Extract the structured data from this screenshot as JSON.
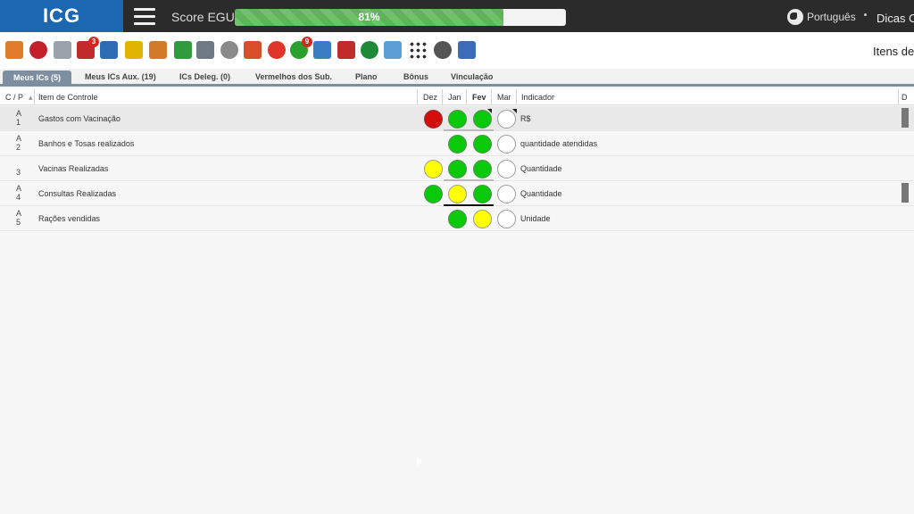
{
  "header": {
    "logo": "ICG",
    "score_label": "Score EGU:",
    "score_text": "81%",
    "score_fraction": 0.81,
    "language": "Português",
    "tips": "Dicas O"
  },
  "toolbar": {
    "icons": [
      {
        "name": "edit-icon",
        "color": "#e07b2a"
      },
      {
        "name": "target-icon",
        "color": "#c3202b"
      },
      {
        "name": "clipboard-icon",
        "color": "#9aa3ab"
      },
      {
        "name": "calendar-alert-icon",
        "color": "#c22b2b",
        "badge": "3"
      },
      {
        "name": "bar-chart-icon",
        "color": "#2d6db3"
      },
      {
        "name": "link-icon",
        "color": "#e0b400"
      },
      {
        "name": "people-icon",
        "color": "#d37a2a"
      },
      {
        "name": "award-icon",
        "color": "#2f9b3d"
      },
      {
        "name": "grid-calendar-icon",
        "color": "#6f7a84"
      },
      {
        "name": "stopwatch-icon",
        "color": "#8a8a8a"
      },
      {
        "name": "org-chart-icon",
        "color": "#d94f2b"
      },
      {
        "name": "crosshair-icon",
        "color": "#e0352b"
      },
      {
        "name": "check-badge-icon",
        "color": "#2ca02c",
        "badge": "9"
      },
      {
        "name": "building-icon",
        "color": "#3b7dc4"
      },
      {
        "name": "pdf-icon",
        "color": "#c22b2b"
      },
      {
        "name": "clock-icon",
        "color": "#1e8a3a"
      },
      {
        "name": "presentation-icon",
        "color": "#5c9fd6"
      },
      {
        "name": "apps-grid-icon",
        "color": "#333333"
      },
      {
        "name": "help-icon",
        "color": "#555555"
      },
      {
        "name": "rocket-icon",
        "color": "#3d6db8"
      }
    ],
    "right_label": "Itens de"
  },
  "tabs": [
    {
      "label": "Meus ICs (5)",
      "active": true
    },
    {
      "label": "Meus ICs Aux. (19)"
    },
    {
      "label": "ICs Deleg. (0)"
    },
    {
      "label": "Vermelhos dos Sub."
    },
    {
      "label": "Plano"
    },
    {
      "label": "Bônus"
    },
    {
      "label": "Vinculação"
    }
  ],
  "table": {
    "headers": {
      "cp": "C / P",
      "item": "Item de Controle",
      "dez": "Dez",
      "jan": "Jan",
      "fev": "Fev",
      "mar": "Mar",
      "indicador": "Indicador",
      "d": "D"
    },
    "rows": [
      {
        "c": "A",
        "p": "1",
        "item": "Gastos com Vacinação",
        "dez": "red",
        "jan": "green",
        "fev": "green",
        "mar": "empty",
        "indicador": "R$"
      },
      {
        "c": "A",
        "p": "2",
        "item": "Banhos e Tosas realizados",
        "dez": "",
        "jan": "green",
        "fev": "green",
        "mar": "empty",
        "indicador": "quantidade atendidas"
      },
      {
        "c": "",
        "p": "3",
        "item": "Vacinas Realizadas",
        "dez": "yellow",
        "jan": "green",
        "fev": "green",
        "mar": "empty",
        "indicador": "Quantidade"
      },
      {
        "c": "A",
        "p": "4",
        "item": "Consultas Realizadas",
        "dez": "green",
        "jan": "yellow",
        "fev": "green",
        "mar": "empty",
        "indicador": "Quantidade"
      },
      {
        "c": "A",
        "p": "5",
        "item": "Rações vendidas",
        "dez": "",
        "jan": "green",
        "fev": "yellow",
        "mar": "empty",
        "indicador": "Unidade"
      }
    ]
  }
}
